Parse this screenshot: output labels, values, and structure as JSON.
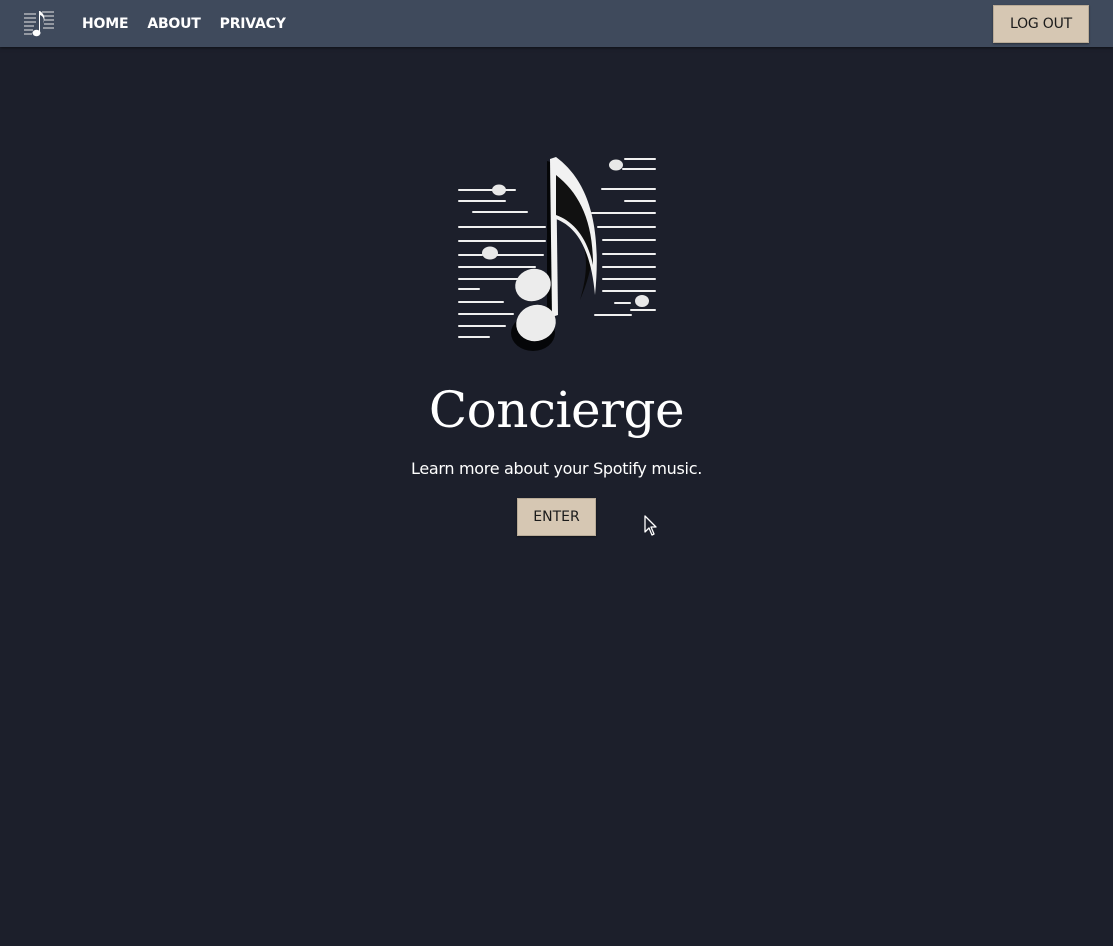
{
  "nav": {
    "logo_icon": "music-note-logo-icon",
    "links": [
      {
        "label": "HOME"
      },
      {
        "label": "ABOUT"
      },
      {
        "label": "PRIVACY"
      }
    ],
    "logout_label": "LOG OUT"
  },
  "hero": {
    "logo_icon": "music-note-staff-icon",
    "title": "Concierge",
    "subtitle": "Learn more about your Spotify music.",
    "enter_label": "ENTER"
  },
  "colors": {
    "background": "#1c1f2b",
    "navbar": "#3f4a5c",
    "button": "#d6c7b3",
    "button_text": "#1b1b1b",
    "text": "#ffffff"
  }
}
